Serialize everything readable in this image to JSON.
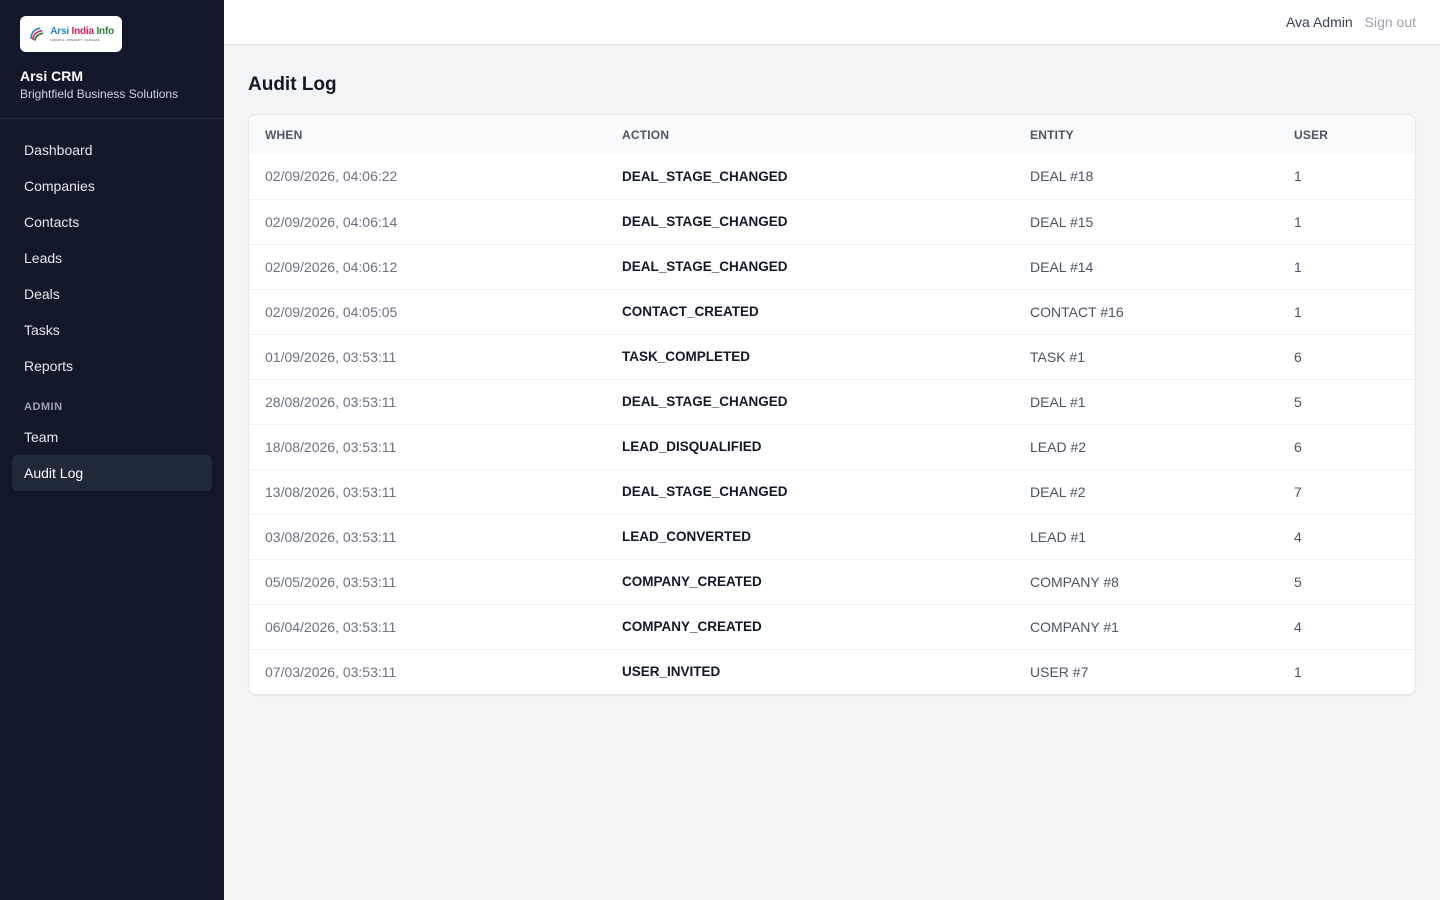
{
  "brand": {
    "logo_word1": "Arsi",
    "logo_word2": "India",
    "logo_word3": "Info",
    "logo_tagline": "GROWTH • INTEGRITY • SUCCESS",
    "app_name": "Arsi CRM",
    "org_name": "Brightfield Business Solutions"
  },
  "sidebar": {
    "items": [
      {
        "label": "Dashboard"
      },
      {
        "label": "Companies"
      },
      {
        "label": "Contacts"
      },
      {
        "label": "Leads"
      },
      {
        "label": "Deals"
      },
      {
        "label": "Tasks"
      },
      {
        "label": "Reports"
      }
    ],
    "admin_section_label": "ADMIN",
    "admin_items": [
      {
        "label": "Team"
      },
      {
        "label": "Audit Log",
        "active": true
      }
    ]
  },
  "header": {
    "user_name": "Ava Admin",
    "sign_out_label": "Sign out"
  },
  "page": {
    "title": "Audit Log"
  },
  "table": {
    "columns": [
      "When",
      "Action",
      "Entity",
      "User"
    ],
    "rows": [
      {
        "when": "02/09/2026, 04:06:22",
        "action": "DEAL_STAGE_CHANGED",
        "entity": "DEAL #18",
        "user": "1"
      },
      {
        "when": "02/09/2026, 04:06:14",
        "action": "DEAL_STAGE_CHANGED",
        "entity": "DEAL #15",
        "user": "1"
      },
      {
        "when": "02/09/2026, 04:06:12",
        "action": "DEAL_STAGE_CHANGED",
        "entity": "DEAL #14",
        "user": "1"
      },
      {
        "when": "02/09/2026, 04:05:05",
        "action": "CONTACT_CREATED",
        "entity": "CONTACT #16",
        "user": "1"
      },
      {
        "when": "01/09/2026, 03:53:11",
        "action": "TASK_COMPLETED",
        "entity": "TASK #1",
        "user": "6"
      },
      {
        "when": "28/08/2026, 03:53:11",
        "action": "DEAL_STAGE_CHANGED",
        "entity": "DEAL #1",
        "user": "5"
      },
      {
        "when": "18/08/2026, 03:53:11",
        "action": "LEAD_DISQUALIFIED",
        "entity": "LEAD #2",
        "user": "6"
      },
      {
        "when": "13/08/2026, 03:53:11",
        "action": "DEAL_STAGE_CHANGED",
        "entity": "DEAL #2",
        "user": "7"
      },
      {
        "when": "03/08/2026, 03:53:11",
        "action": "LEAD_CONVERTED",
        "entity": "LEAD #1",
        "user": "4"
      },
      {
        "when": "05/05/2026, 03:53:11",
        "action": "COMPANY_CREATED",
        "entity": "COMPANY #8",
        "user": "5"
      },
      {
        "when": "06/04/2026, 03:53:11",
        "action": "COMPANY_CREATED",
        "entity": "COMPANY #1",
        "user": "4"
      },
      {
        "when": "07/03/2026, 03:53:11",
        "action": "USER_INVITED",
        "entity": "USER #7",
        "user": "1"
      }
    ]
  },
  "colors": {
    "sidebar_bg": "#111827",
    "active_item_bg": "#1f2937",
    "page_bg": "#f3f4f6"
  }
}
